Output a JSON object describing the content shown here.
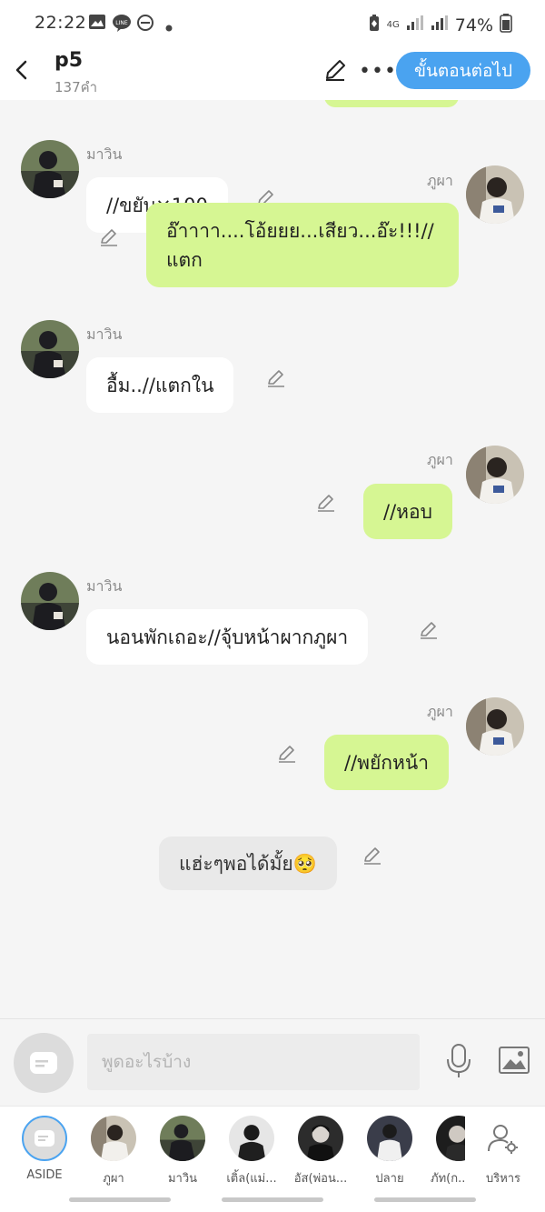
{
  "status": {
    "time": "22:22",
    "network": "4G",
    "battery": "74%"
  },
  "header": {
    "title": "p5",
    "word_count": "137คำ",
    "next_button": "ขั้นตอนต่อไป"
  },
  "colors": {
    "accent": "#4aa3f0",
    "right_bubble": "#d6f693",
    "left_bubble": "#ffffff"
  },
  "messages": [
    {
      "side": "left",
      "sender": "มาวิน",
      "text": "//ขยับ×100"
    },
    {
      "side": "right",
      "sender": "ภูผา",
      "text_line1": "อ๊าาาา....โอ้ยยย...เสียว...อ๊ะ!!!//",
      "text_line2": "แตก"
    },
    {
      "side": "left",
      "sender": "มาวิน",
      "text": "อื้ม..//แตกใน"
    },
    {
      "side": "right",
      "sender": "ภูผา",
      "text": "//หอบ"
    },
    {
      "side": "left",
      "sender": "มาวิน",
      "text": "นอนพักเถอะ//จุ้บหน้าผากภูผา"
    },
    {
      "side": "right",
      "sender": "ภูผา",
      "text": "//พยักหน้า"
    },
    {
      "side": "narration",
      "text": "แฮ่ะๆพอได้มั้ย🥺"
    }
  ],
  "input": {
    "placeholder": "พูดอะไรบ้าง"
  },
  "characters": [
    {
      "label": "ASIDE"
    },
    {
      "label": "ภูผา"
    },
    {
      "label": "มาวิน"
    },
    {
      "label": "เติ้ล(แม่..."
    },
    {
      "label": "อัส(พ่อน..."
    },
    {
      "label": "ปลาย"
    },
    {
      "label": "ภัท(ก..."
    },
    {
      "label": "บริหาร"
    }
  ]
}
